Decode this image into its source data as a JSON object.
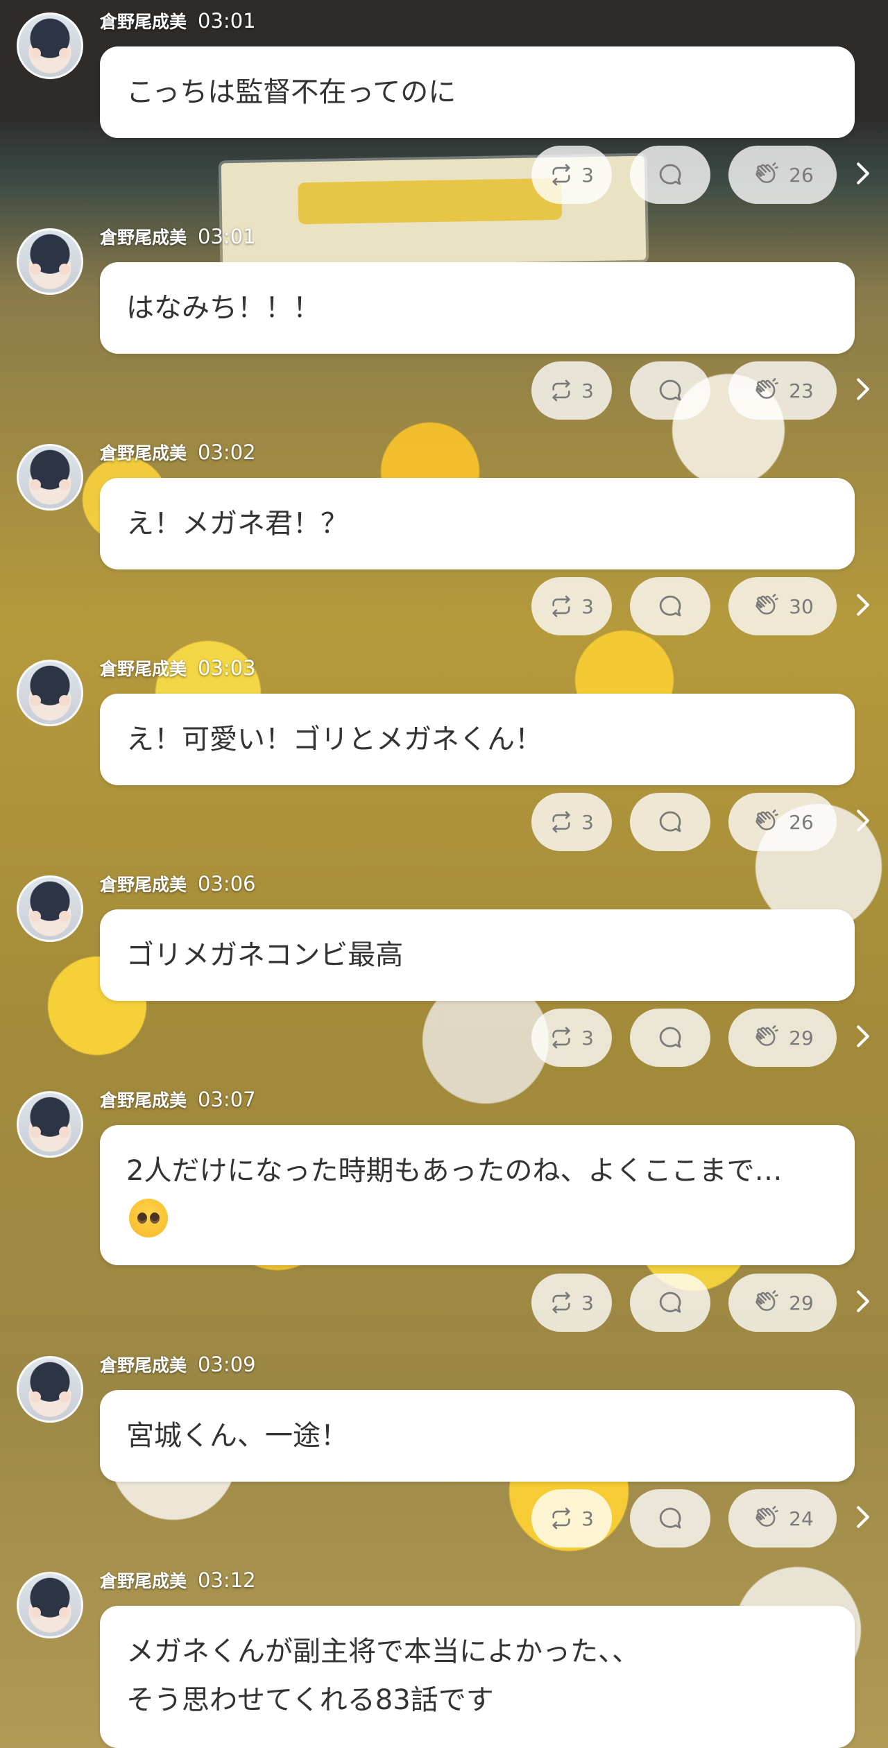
{
  "user": {
    "name": "倉野尾成美"
  },
  "messages": [
    {
      "time": "03:01",
      "text": "こっちは監督不在ってのに",
      "reposts": "3",
      "claps": "26"
    },
    {
      "time": "03:01",
      "text": "はなみち！！！",
      "reposts": "3",
      "claps": "23"
    },
    {
      "time": "03:02",
      "text": "え！メガネ君！？",
      "reposts": "3",
      "claps": "30"
    },
    {
      "time": "03:03",
      "text": "え！可愛い！ゴリとメガネくん！",
      "reposts": "3",
      "claps": "26"
    },
    {
      "time": "03:06",
      "text": "ゴリメガネコンビ最高",
      "reposts": "3",
      "claps": "29"
    },
    {
      "time": "03:07",
      "text": "2人だけになった時期もあったのね、よくここまで…",
      "emoji": "pleading-face-emoji",
      "reposts": "3",
      "claps": "29"
    },
    {
      "time": "03:09",
      "text": "宮城くん、一途！",
      "reposts": "3",
      "claps": "24"
    },
    {
      "time": "03:12",
      "text_lines": [
        "メガネくんが副主将で本当によかった、、",
        "そう思わせてくれる83話です"
      ]
    }
  ],
  "icons": {
    "repost": "repost-icon",
    "reply": "reply-bubble-icon",
    "clap": "clap-icon",
    "more": "chevron-right-icon"
  },
  "colors": {
    "bubble": "#ffffff",
    "text": "#333333",
    "pill": "#f2f2f2",
    "icon": "#7a7a7a"
  }
}
